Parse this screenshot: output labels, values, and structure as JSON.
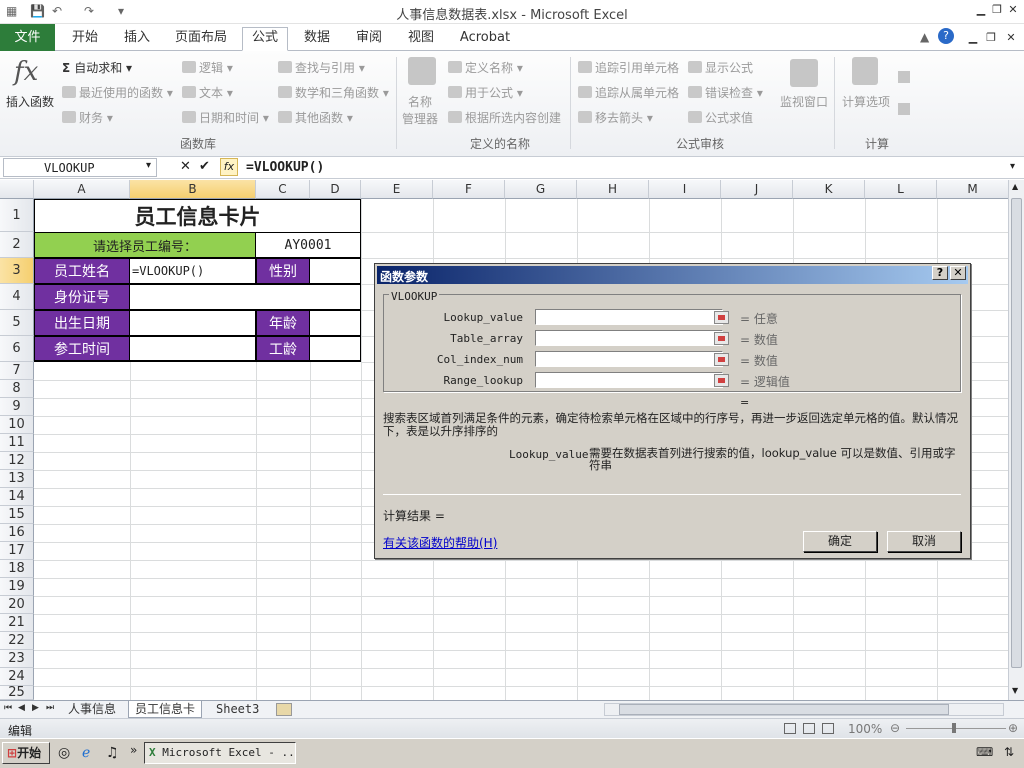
{
  "window": {
    "title": "人事信息数据表.xlsx  -  Microsoft Excel"
  },
  "tabs": [
    "文件",
    "开始",
    "插入",
    "页面布局",
    "公式",
    "数据",
    "审阅",
    "视图",
    "Acrobat"
  ],
  "ribbon": {
    "insert_function": "插入函数",
    "autosum": "自动求和",
    "recent": "最近使用的函数",
    "finance": "财务",
    "logic": "逻辑",
    "text": "文本",
    "datetime": "日期和时间",
    "lookup": "查找与引用",
    "math": "数学和三角函数",
    "other": "其他函数",
    "group_lib": "函数库",
    "name_mgr_1": "名称",
    "name_mgr_2": "管理器",
    "define_name": "定义名称",
    "use_in_formula": "用于公式",
    "create_from_sel": "根据所选内容创建",
    "group_names": "定义的名称",
    "trace_prec": "追踪引用单元格",
    "trace_dep": "追踪从属单元格",
    "remove_arrows": "移去箭头",
    "show_formulas": "显示公式",
    "error_check": "错误检查",
    "eval_formula": "公式求值",
    "watch": "监视窗口",
    "group_audit": "公式审核",
    "calc_options": "计算选项",
    "group_calc": "计算"
  },
  "formula_bar": {
    "name_box": "VLOOKUP",
    "fx": "fx",
    "formula": "=VLOOKUP()"
  },
  "columns": [
    "A",
    "B",
    "C",
    "D",
    "E",
    "F",
    "G",
    "H",
    "I",
    "J",
    "K",
    "L",
    "M"
  ],
  "rows": [
    "1",
    "2",
    "3",
    "4",
    "5",
    "6",
    "7",
    "8",
    "9",
    "10",
    "11",
    "12",
    "13",
    "14",
    "15",
    "16",
    "17",
    "18",
    "19",
    "20",
    "21",
    "22",
    "23",
    "24",
    "25"
  ],
  "card": {
    "title": "员工信息卡片",
    "select_label": "请选择员工编号：",
    "employee_id": "AY0001",
    "name_label": "员工姓名",
    "b3_formula": "=VLOOKUP()",
    "gender_label": "性别",
    "id_label": "身份证号",
    "birth_label": "出生日期",
    "age_label": "年龄",
    "join_label": "参工时间",
    "seniority_label": "工龄"
  },
  "dialog": {
    "title": "函数参数",
    "help_q": "?",
    "close": "✕",
    "group": "VLOOKUP",
    "args": [
      {
        "name": "Lookup_value",
        "result": "= 任意"
      },
      {
        "name": "Table_array",
        "result": "= 数值"
      },
      {
        "name": "Col_index_num",
        "result": "= 数值"
      },
      {
        "name": "Range_lookup",
        "result": "= 逻辑值"
      }
    ],
    "eq": "=",
    "description": "搜索表区域首列满足条件的元素，确定待检索单元格在区域中的行序号，再进一步返回选定单元格的值。默认情况下，表是以升序排序的",
    "param_name": "Lookup_value",
    "param_desc": "需要在数据表首列进行搜索的值，lookup_value 可以是数值、引用或字符串",
    "calc_result": "计算结果 =",
    "help_link": "有关该函数的帮助(H)",
    "ok": "确定",
    "cancel": "取消"
  },
  "sheets": [
    "人事信息",
    "员工信息卡",
    "Sheet3"
  ],
  "status": {
    "mode": "编辑",
    "zoom": "100%"
  },
  "taskbar": {
    "start": "开始",
    "task": "Microsoft Excel - ..."
  }
}
